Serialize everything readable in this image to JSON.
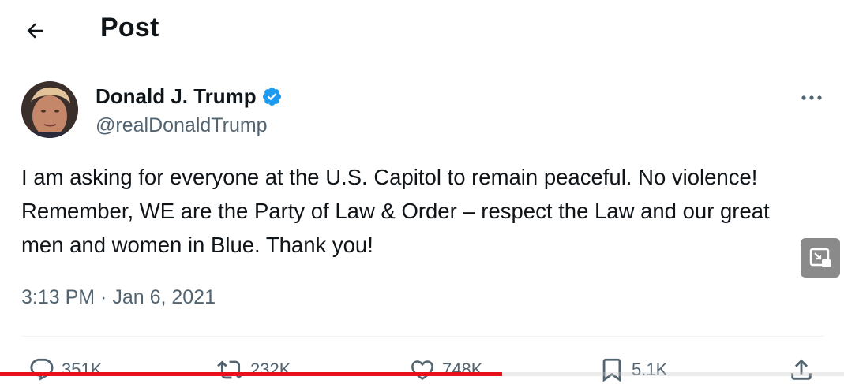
{
  "header": {
    "title": "Post",
    "back_icon": "arrow-left-icon"
  },
  "author": {
    "name": "Donald J. Trump",
    "handle": "@realDonaldTrump",
    "verified_icon": "verified-badge-icon",
    "verified_color": "#1d9bf0"
  },
  "post": {
    "text": "I am asking for everyone at the U.S. Capitol to remain peaceful. No violence! Remember, WE are the Party of Law & Order – respect the Law and our great men and women in Blue. Thank you!",
    "timestamp": "3:13 PM · Jan 6, 2021"
  },
  "actions": {
    "reply_count": "351K",
    "repost_count": "232K",
    "like_count": "748K",
    "bookmark_count": "5.1K"
  },
  "video_player": {
    "progress_fraction": 0.595,
    "progress_color": "#e8111a",
    "pip_icon": "picture-in-picture-icon"
  }
}
